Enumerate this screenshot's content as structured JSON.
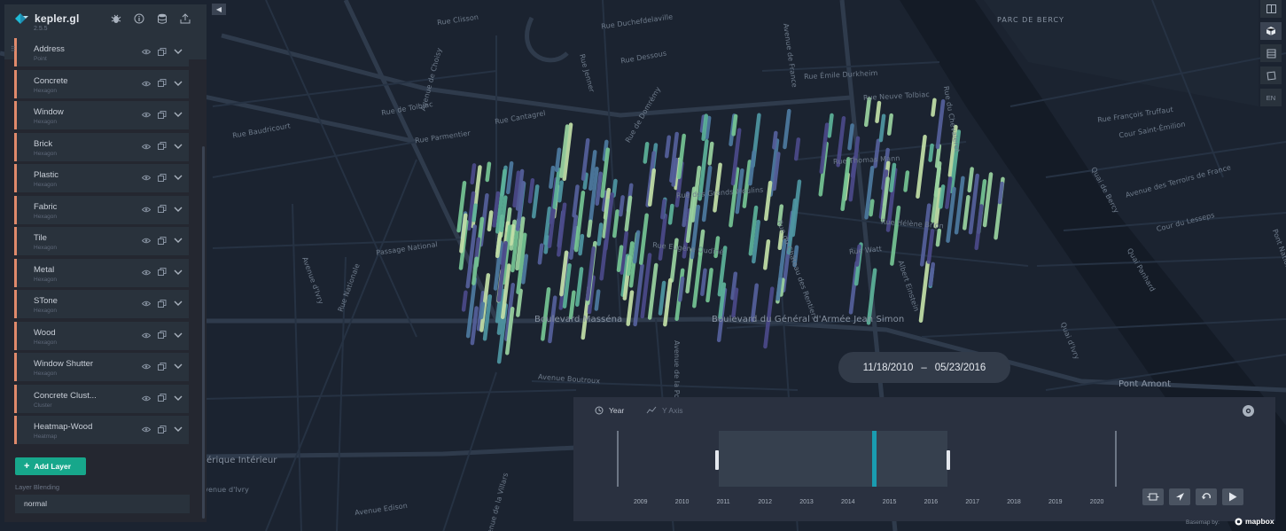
{
  "app": {
    "name": "kepler.gl",
    "version": "2.5.5"
  },
  "colors": {
    "accent": "#17a78b",
    "layer_bar": "#e08a6b",
    "timeline_cursor": "#1a9cb0",
    "panel": "#242730",
    "map_bg": "#1b2330"
  },
  "header": {
    "icons": [
      "bug-icon",
      "info-icon",
      "database-icon",
      "upload-icon"
    ],
    "tabs": [
      "layers-icon",
      "filter-icon",
      "interactions-icon",
      "map-settings-icon"
    ]
  },
  "layers": [
    {
      "name": "Address",
      "type": "Point"
    },
    {
      "name": "Concrete",
      "type": "Hexagon"
    },
    {
      "name": "Window",
      "type": "Hexagon"
    },
    {
      "name": "Brick",
      "type": "Hexagon"
    },
    {
      "name": "Plastic",
      "type": "Hexagon"
    },
    {
      "name": "Fabric",
      "type": "Hexagon"
    },
    {
      "name": "Tile",
      "type": "Hexagon"
    },
    {
      "name": "Metal",
      "type": "Hexagon"
    },
    {
      "name": "STone",
      "type": "Hexagon"
    },
    {
      "name": "Wood",
      "type": "Hexagon"
    },
    {
      "name": "Window Shutter",
      "type": "Hexagon"
    },
    {
      "name": "Concrete Clust...",
      "type": "Cluster"
    },
    {
      "name": "Heatmap-Wood",
      "type": "Heatmap"
    }
  ],
  "add_layer_label": "Add Layer",
  "blending": {
    "label": "Layer Blending",
    "value": "normal"
  },
  "right_toolbar": {
    "lang": "EN"
  },
  "time_range": {
    "start": "11/18/2010",
    "sep": "–",
    "end": "05/23/2016"
  },
  "timeline": {
    "interval_label": "Year",
    "yaxis_label": "Y Axis",
    "years": [
      "2009",
      "2010",
      "2011",
      "2012",
      "2013",
      "2014",
      "2015",
      "2016",
      "2017",
      "2018",
      "2019",
      "2020"
    ],
    "buttons": [
      "window-icon",
      "rocket-icon",
      "reset-icon",
      "play-icon"
    ]
  },
  "map_labels": {
    "park": "PARC DE BERCY",
    "boulevard_massena": "Boulevard Masséna",
    "boulevard_general": "Boulevard du Général d'Armée Jean Simon",
    "pont_amont": "Pont Amont",
    "avenue_boutroux": "Avenue Boutroux",
    "peripherique": "érique Intérieur",
    "quai_ivry": "Quai d'Ivry",
    "rue_tolbiac": "Rue de Tolbiac",
    "rue_baudricourt": "Rue Baudricourt",
    "rue_parmentier": "Rue Parmentier",
    "rue_nationale": "Rue Nationale",
    "passage_national": "Passage National",
    "rue_grands_moulins": "Rue des Grands Moulins",
    "rue_eugene": "Rue Eugène Oudiné",
    "rue_thomas_mann": "Rue Thomas Mann",
    "rue_helene_brion": "Rue Hélène Brion",
    "rue_watt": "Rue Watt",
    "albert_einstein": "Albert Einstein",
    "rue_emile_durkheim": "Rue Émile Durkheim",
    "rue_neuve_tolbiac": "Rue Neuve Tolbiac",
    "rue_francois_truffaut": "Rue François Truffaut",
    "cour_saint_emilion": "Cour Saint-Émilion",
    "avenue_terroirs": "Avenue des Terroirs de France",
    "quai_bercy": "Quai de Bercy",
    "cour_lesseps": "Cour du Lesseps",
    "avenue_ivry": "Avenue d'Ivry",
    "avenue_choisy": "Avenue de Choisy",
    "avenue_france": "Avenue de France",
    "rue_chevaleret": "Rue du Chevaleret",
    "avenue_porte": "Avenue de la Porte",
    "quai_panhard": "Quai Panhard",
    "pont_national": "Pont National",
    "rue_clisson": "Rue Clisson",
    "rue_duchefdelaville": "Rue Duchefdelaville",
    "rue_nationale_2": "Rue Jenner",
    "rue_dessous": "Rue Dessous",
    "rue_carrey": "Rue Cantagrel",
    "rue_domremy": "Rue de Domrémy",
    "rue_chateau": "Rue du Château des Rentiers",
    "avenue_edison": "Avenue Edison",
    "avenue_villars": "Avenue de la Villars",
    "avenue_ivry_2": "Avenue d'Ivry",
    "basemap": "Basemap by:",
    "mapbox": "mapbox"
  }
}
